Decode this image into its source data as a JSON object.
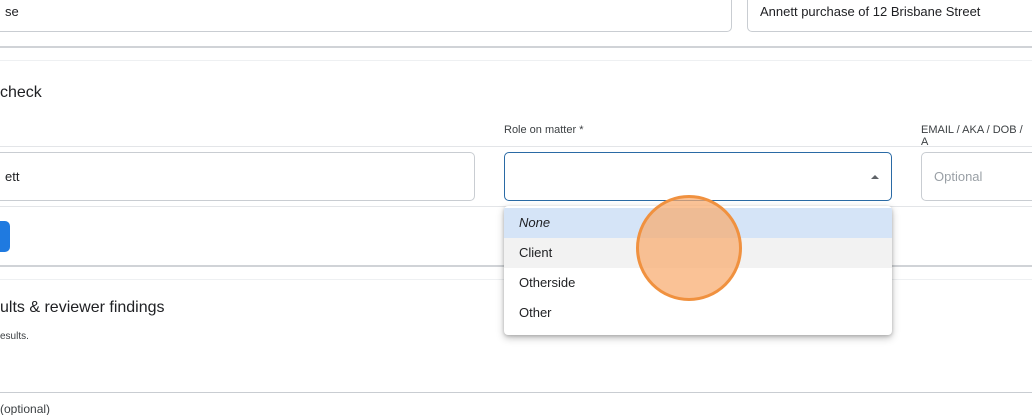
{
  "top_fields": {
    "left_value": "se",
    "right_value": "Annett purchase of 12 Brisbane Street"
  },
  "check_section": {
    "title": "check",
    "headers": {
      "role": "Role on matter *",
      "email": "EMAIL / AKA / DOB / A"
    },
    "name_value": "ett",
    "role_value": "",
    "email_placeholder": "Optional"
  },
  "role_menu": {
    "options": [
      "None",
      "Client",
      "Otherside",
      "Other"
    ],
    "selected": "None",
    "hovered": "Client"
  },
  "results_section": {
    "title": "ults & reviewer findings",
    "subtitle": "esults."
  },
  "bottom_section": {
    "label": "(optional)"
  },
  "colors": {
    "accent": "#1f7ae0",
    "selected_option": "#d5e4f7",
    "cursor_highlight": "#f0913f"
  }
}
